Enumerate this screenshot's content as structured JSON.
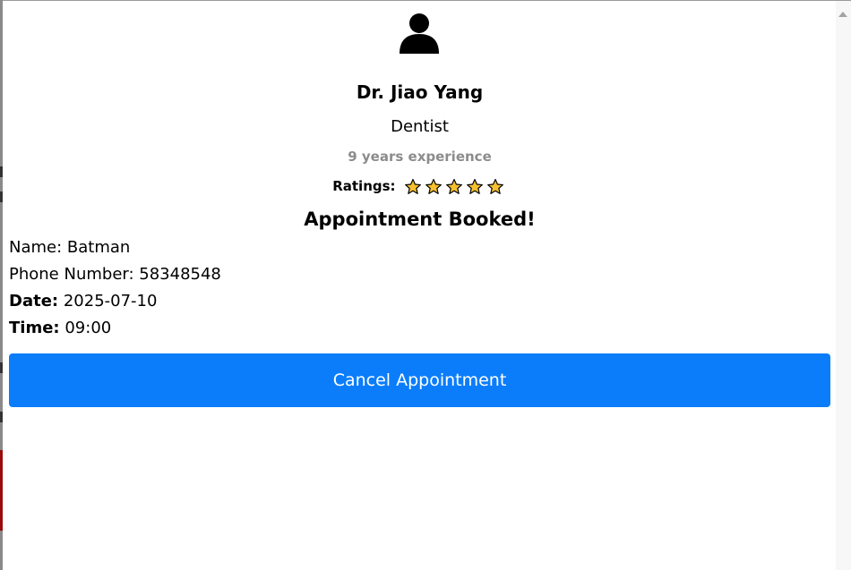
{
  "doctor": {
    "name": "Dr. Jiao Yang",
    "specialty": "Dentist",
    "experience": "9 years experience",
    "ratings_label": "Ratings:",
    "rating_stars": 5
  },
  "appointment": {
    "title": "Appointment Booked!",
    "name_line": "Name: Batman",
    "phone_line": "Phone Number: 58348548",
    "date_label": "Date:",
    "date_value": " 2025-07-10",
    "time_label": "Time:",
    "time_value": " 09:00",
    "cancel_label": "Cancel Appointment"
  },
  "icons": {
    "avatar": "user-icon",
    "star": "star-icon",
    "scroll_up": "triangle-up-icon"
  },
  "colors": {
    "button": "#0b7dfb",
    "star_fill": "#f6c02f",
    "experience_text": "#8c8c8c"
  }
}
